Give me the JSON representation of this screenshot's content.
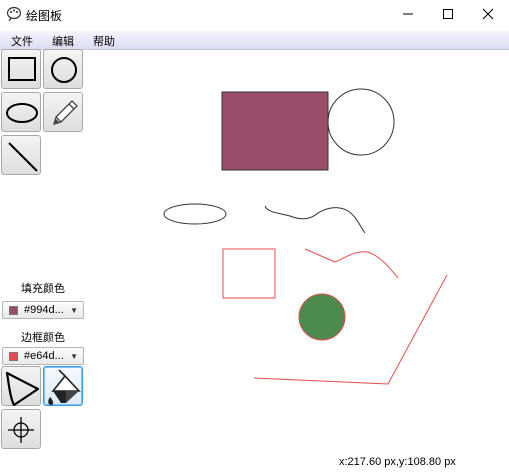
{
  "window": {
    "title": "绘图板",
    "minimize_glyph": "—",
    "maximize_glyph": "☐",
    "close_glyph": "✕"
  },
  "menu": {
    "items": [
      {
        "label": "文件"
      },
      {
        "label": "编辑"
      },
      {
        "label": "帮助"
      }
    ]
  },
  "tools": [
    {
      "name": "rectangle-icon"
    },
    {
      "name": "circle-icon"
    },
    {
      "name": "ellipse-icon"
    },
    {
      "name": "pencil-icon"
    },
    {
      "name": "line-icon"
    },
    {
      "name": "polygon-icon"
    },
    {
      "name": "fill-bucket-icon",
      "selected": true
    },
    {
      "name": "crosshair-icon"
    }
  ],
  "fill_color": {
    "label": "填充颜色",
    "value": "#994d...",
    "swatch": "#994d6b"
  },
  "border_color": {
    "label": "边框颜色",
    "value": "#e64d...",
    "swatch": "#e64d4d"
  },
  "canvas_colors": {
    "rect_fill": "#994d6b",
    "circle_fill": "#4d8a4d",
    "red_stroke": "#e64d4d",
    "black_stroke": "#333333"
  },
  "status": {
    "coordinates": "x:217.60 px,y:108.80 px"
  }
}
